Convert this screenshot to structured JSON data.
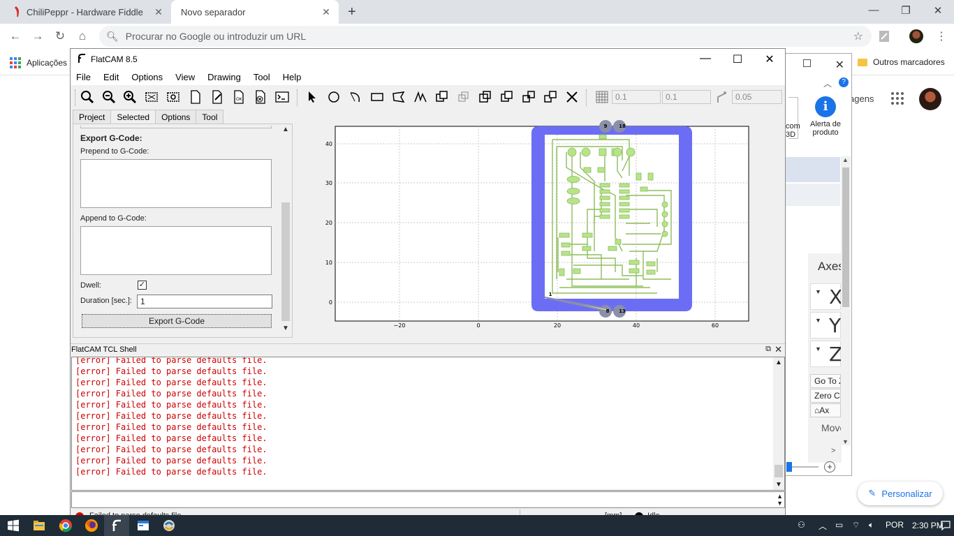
{
  "browser": {
    "tabs": [
      {
        "title": "ChiliPeppr - Hardware Fiddle",
        "active": false
      },
      {
        "title": "Novo separador",
        "active": true
      }
    ],
    "omnibox_placeholder": "Procurar no Google ou introduzir um URL",
    "bookmarks": {
      "apps": "Aplicações",
      "other": "Outros marcadores"
    },
    "page_texts": {
      "gtext": "agens",
      "personalizar": "Personalizar"
    }
  },
  "chili": {
    "com_label": "com\n3D",
    "alert_label": "Alerta de\nproduto",
    "axes_title": "Axes",
    "axes": [
      "X",
      "Y",
      "Z"
    ],
    "goto_label": "Go To Z",
    "zero_label": "Zero C",
    "home_label": "Ax",
    "move_label": "Move"
  },
  "flatcam": {
    "title": "FlatCAM 8.5",
    "menu": [
      "File",
      "Edit",
      "Options",
      "View",
      "Drawing",
      "Tool",
      "Help"
    ],
    "toolbar_values": {
      "grid_x": "0.1",
      "grid_y": "0.1",
      "snap_max": "0.05"
    },
    "tabs": [
      "Project",
      "Selected",
      "Options",
      "Tool"
    ],
    "active_tab": "Selected",
    "panel": {
      "heading": "Export G-Code:",
      "prepend_label": "Prepend to G-Code:",
      "append_label": "Append to G-Code:",
      "dwell_label": "Dwell:",
      "dwell_checked": true,
      "duration_label": "Duration [sec.]:",
      "duration_value": "1",
      "export_button": "Export G-Code"
    },
    "plot": {
      "x_ticks": [
        "−20",
        "0",
        "20",
        "40",
        "60"
      ],
      "y_ticks": [
        "0",
        "10",
        "20",
        "30",
        "40"
      ],
      "markers": [
        "9",
        "18",
        "8",
        "13",
        "1"
      ]
    },
    "shell": {
      "title": "FlatCAM TCL Shell",
      "lines": [
        "[error] Failed to parse defaults file.",
        "[error] Failed to parse defaults file.",
        "[error] Failed to parse defaults file.",
        "[error] Failed to parse defaults file.",
        "[error] Failed to parse defaults file.",
        "[error] Failed to parse defaults file.",
        "[error] Failed to parse defaults file.",
        "[error] Failed to parse defaults file.",
        "[error] Failed to parse defaults file.",
        "[error] Failed to parse defaults file.",
        "[error] Failed to parse defaults file."
      ]
    },
    "status": {
      "message": "Failed to parse defaults file.",
      "units": "[mm]",
      "state": "Idle"
    }
  },
  "taskbar": {
    "language": "POR",
    "time": "2:30 PM"
  },
  "colors": {
    "board": "#6b6ef5",
    "traces": "#b7e48a",
    "error_text": "#cc0000",
    "accent": "#1a73e8"
  }
}
